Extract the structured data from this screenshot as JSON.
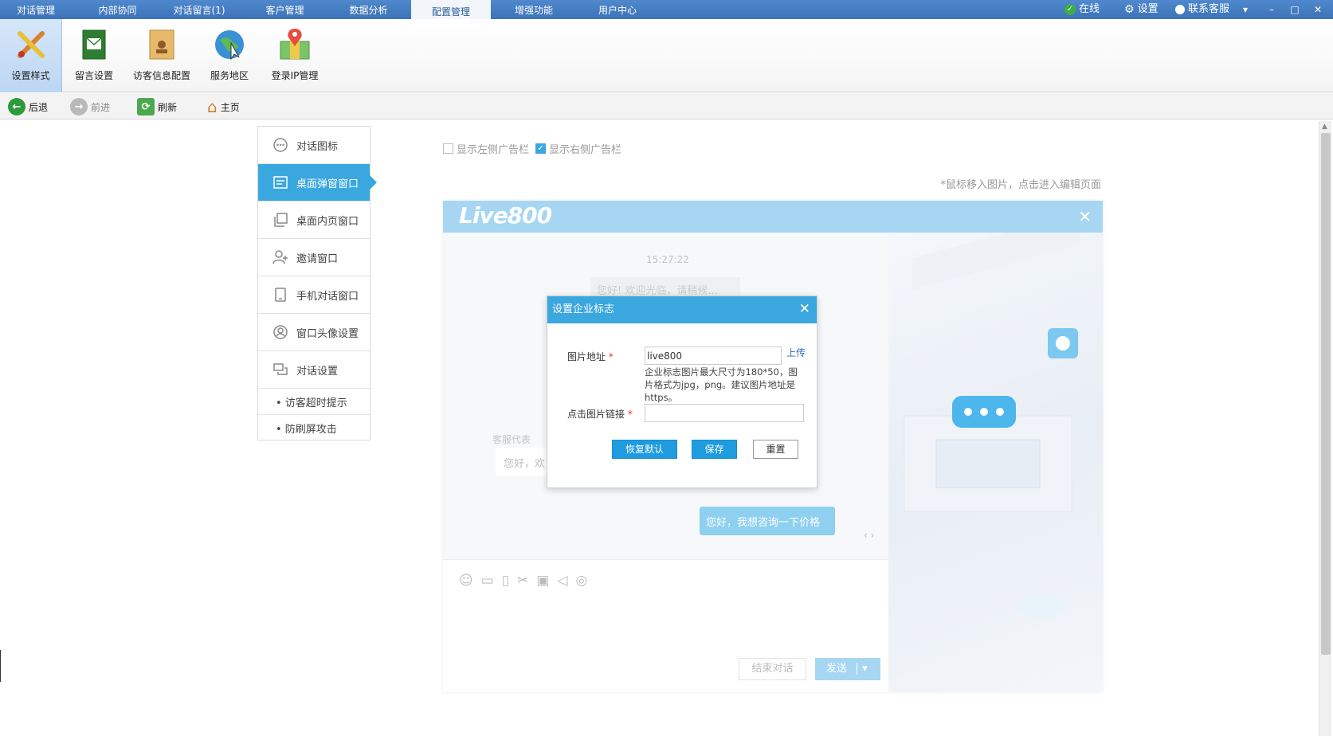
{
  "topbar": {
    "tabs": [
      {
        "label": "对话管理"
      },
      {
        "label": "内部协同"
      },
      {
        "label": "对话留言(1)"
      },
      {
        "label": "客户管理"
      },
      {
        "label": "数据分析"
      },
      {
        "label": "配置管理",
        "active": true
      },
      {
        "label": "增强功能"
      },
      {
        "label": "用户中心"
      }
    ],
    "status_label": "在线",
    "settings_label": "设置",
    "contact_label": "联系客服"
  },
  "ribbon": {
    "items": [
      {
        "label": "设置样式",
        "icon": "brush-pencil-icon",
        "active": true
      },
      {
        "label": "留言设置",
        "icon": "message-book-icon"
      },
      {
        "label": "访客信息配置",
        "icon": "visitor-envelope-icon"
      },
      {
        "label": "服务地区",
        "icon": "globe-icon"
      },
      {
        "label": "登录IP管理",
        "icon": "map-pin-icon"
      }
    ]
  },
  "navbar": {
    "back": "后退",
    "forward": "前进",
    "refresh": "刷新",
    "home": "主页"
  },
  "sidemenu": {
    "items": [
      {
        "label": "对话图标",
        "icon": "chat-bubble-icon"
      },
      {
        "label": "桌面弹窗窗口",
        "icon": "window-icon",
        "active": true
      },
      {
        "label": "桌面内页窗口",
        "icon": "pages-icon"
      },
      {
        "label": "邀请窗口",
        "icon": "user-add-icon"
      },
      {
        "label": "手机对话窗口",
        "icon": "mobile-icon"
      },
      {
        "label": "窗口头像设置",
        "icon": "avatar-icon"
      },
      {
        "label": "对话设置",
        "icon": "conversation-icon"
      }
    ],
    "subitems": [
      {
        "label": "• 访客超时提示"
      },
      {
        "label": "• 防刷屏攻击"
      }
    ]
  },
  "options": {
    "left_ad_label": "显示左侧广告栏",
    "left_ad_checked": false,
    "right_ad_label": "显示右侧广告栏",
    "right_ad_checked": true,
    "hint": "*鼠标移入图片，点击进入编辑页面"
  },
  "preview": {
    "logo_text": "Live800",
    "time": "15:27:22",
    "greeting_ghost": "您好! 欢迎光临，请稍候...",
    "agent_label": "客服代表",
    "agent_message": "您好，欢",
    "user_message": "您好，我想咨询一下价格",
    "pager": "‹  ›",
    "end_button": "结束对话",
    "send_button": "发送"
  },
  "dialog": {
    "title": "设置企业标志",
    "image_url_label": "图片地址",
    "image_url_value": "live800",
    "upload_label": "上传",
    "note": "企业标志图片最大尺寸为180*50，图片格式为jpg，png。建议图片地址是https。",
    "link_label": "点击图片链接",
    "link_value": "",
    "reset_default": "恢复默认",
    "save": "保存",
    "reset": "重置"
  },
  "colors": {
    "accent": "#3aa7df",
    "topbar": "#4a82c6",
    "preview_header": "#a6d6f2"
  }
}
